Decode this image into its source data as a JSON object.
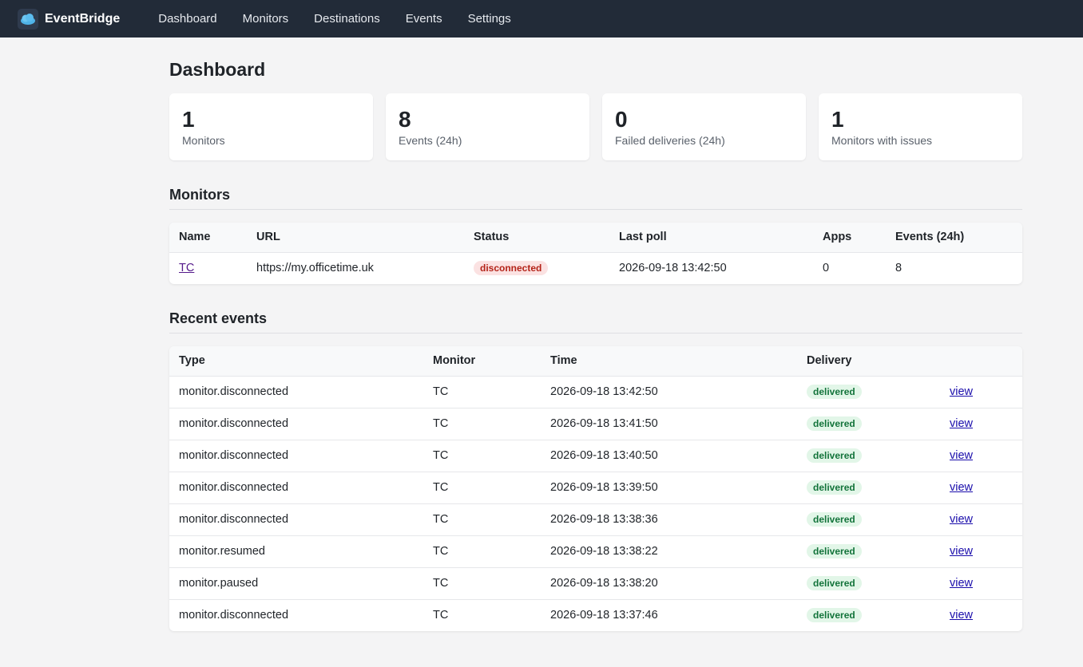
{
  "app": {
    "name": "EventBridge"
  },
  "nav": [
    "Dashboard",
    "Monitors",
    "Destinations",
    "Events",
    "Settings"
  ],
  "page_title": "Dashboard",
  "stats": [
    {
      "value": "1",
      "label": "Monitors"
    },
    {
      "value": "8",
      "label": "Events (24h)"
    },
    {
      "value": "0",
      "label": "Failed deliveries (24h)"
    },
    {
      "value": "1",
      "label": "Monitors with issues"
    }
  ],
  "monitors": {
    "title": "Monitors",
    "headers": [
      "Name",
      "URL",
      "Status",
      "Last poll",
      "Apps",
      "Events (24h)"
    ],
    "rows": [
      {
        "name": "TC",
        "url": "https://my.officetime.uk",
        "status": "disconnected",
        "last_poll": "2026-09-18 13:42:50",
        "apps": "0",
        "events": "8"
      }
    ]
  },
  "recent_events": {
    "title": "Recent events",
    "headers": [
      "Type",
      "Monitor",
      "Time",
      "Delivery"
    ],
    "action_label": "view",
    "rows": [
      {
        "type": "monitor.disconnected",
        "monitor": "TC",
        "time": "2026-09-18 13:42:50",
        "delivery": "delivered"
      },
      {
        "type": "monitor.disconnected",
        "monitor": "TC",
        "time": "2026-09-18 13:41:50",
        "delivery": "delivered"
      },
      {
        "type": "monitor.disconnected",
        "monitor": "TC",
        "time": "2026-09-18 13:40:50",
        "delivery": "delivered"
      },
      {
        "type": "monitor.disconnected",
        "monitor": "TC",
        "time": "2026-09-18 13:39:50",
        "delivery": "delivered"
      },
      {
        "type": "monitor.disconnected",
        "monitor": "TC",
        "time": "2026-09-18 13:38:36",
        "delivery": "delivered"
      },
      {
        "type": "monitor.resumed",
        "monitor": "TC",
        "time": "2026-09-18 13:38:22",
        "delivery": "delivered"
      },
      {
        "type": "monitor.paused",
        "monitor": "TC",
        "time": "2026-09-18 13:38:20",
        "delivery": "delivered"
      },
      {
        "type": "monitor.disconnected",
        "monitor": "TC",
        "time": "2026-09-18 13:37:46",
        "delivery": "delivered"
      }
    ]
  },
  "colors": {
    "topbar": "#222b38",
    "status_error_bg": "#fbe2e2",
    "status_error_fg": "#b42318",
    "status_ok_bg": "#e2f6e8",
    "status_ok_fg": "#12733a",
    "link": "#1a0dab"
  },
  "icons": {
    "brand": "cloud-logo-icon"
  }
}
